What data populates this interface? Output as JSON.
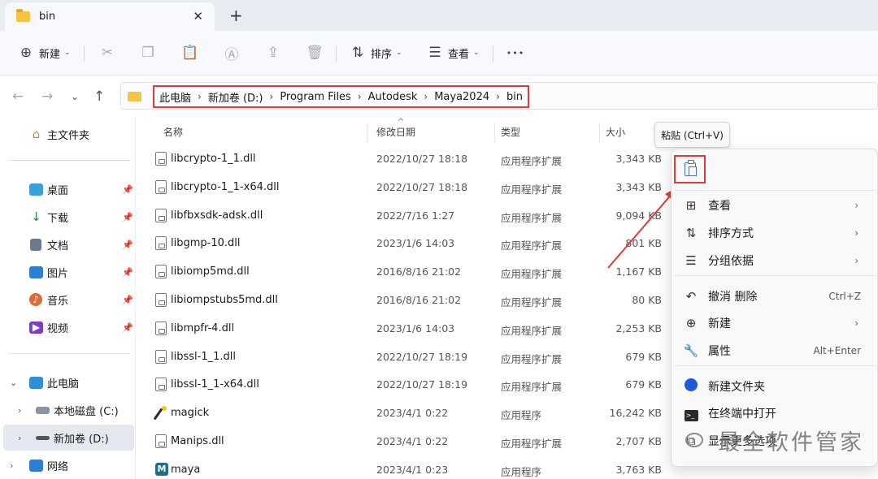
{
  "tab": {
    "title": "bin",
    "close_glyph": "✕",
    "new_tab_glyph": "+"
  },
  "toolbar": {
    "new_label": "新建",
    "sort_label": "排序",
    "view_label": "查看",
    "more_glyph": "•••"
  },
  "breadcrumb": [
    "此电脑",
    "新加卷 (D:)",
    "Program Files",
    "Autodesk",
    "Maya2024",
    "bin"
  ],
  "sidebar": {
    "home": "主文件夹",
    "pinned": [
      "桌面",
      "下载",
      "文档",
      "图片",
      "音乐",
      "视频"
    ],
    "this_pc": "此电脑",
    "drives": [
      "本地磁盘 (C:)",
      "新加卷 (D:)"
    ],
    "network": "网络"
  },
  "columns": {
    "name": "名称",
    "modified": "修改日期",
    "type": "类型",
    "size": "大小"
  },
  "files": [
    {
      "name": "libcrypto-1_1.dll",
      "modified": "2022/10/27 18:18",
      "type": "应用程序扩展",
      "size": "3,343 KB",
      "icon": "dll-icon"
    },
    {
      "name": "libcrypto-1_1-x64.dll",
      "modified": "2022/10/27 18:18",
      "type": "应用程序扩展",
      "size": "3,343 KB",
      "icon": "dll-icon"
    },
    {
      "name": "libfbxsdk-adsk.dll",
      "modified": "2022/7/16 1:27",
      "type": "应用程序扩展",
      "size": "9,094 KB",
      "icon": "dll-icon"
    },
    {
      "name": "libgmp-10.dll",
      "modified": "2023/1/6 14:03",
      "type": "应用程序扩展",
      "size": "801 KB",
      "icon": "dll-icon"
    },
    {
      "name": "libiomp5md.dll",
      "modified": "2016/8/16 21:02",
      "type": "应用程序扩展",
      "size": "1,167 KB",
      "icon": "dll-icon"
    },
    {
      "name": "libiompstubs5md.dll",
      "modified": "2016/8/16 21:02",
      "type": "应用程序扩展",
      "size": "80 KB",
      "icon": "dll-icon"
    },
    {
      "name": "libmpfr-4.dll",
      "modified": "2023/1/6 14:03",
      "type": "应用程序扩展",
      "size": "2,253 KB",
      "icon": "dll-icon"
    },
    {
      "name": "libssl-1_1.dll",
      "modified": "2022/10/27 18:19",
      "type": "应用程序扩展",
      "size": "679 KB",
      "icon": "dll-icon"
    },
    {
      "name": "libssl-1_1-x64.dll",
      "modified": "2022/10/27 18:19",
      "type": "应用程序扩展",
      "size": "679 KB",
      "icon": "dll-icon"
    },
    {
      "name": "magick",
      "modified": "2023/4/1 0:22",
      "type": "应用程序",
      "size": "16,242 KB",
      "icon": "magick-icon"
    },
    {
      "name": "Manips.dll",
      "modified": "2023/4/1 0:22",
      "type": "应用程序扩展",
      "size": "2,707 KB",
      "icon": "dll-icon"
    },
    {
      "name": "maya",
      "modified": "2023/4/1 0:23",
      "type": "应用程序",
      "size": "3,763 KB",
      "icon": "maya-icon"
    }
  ],
  "tooltip": "粘贴 (Ctrl+V)",
  "context_menu": {
    "items": [
      {
        "label": "查看",
        "shortcut": "",
        "has_submenu": true,
        "icon": "grid-icon"
      },
      {
        "label": "排序方式",
        "shortcut": "",
        "has_submenu": true,
        "icon": "sort-icon"
      },
      {
        "label": "分组依据",
        "shortcut": "",
        "has_submenu": true,
        "icon": "group-icon"
      },
      {
        "label": "撤消 删除",
        "shortcut": "Ctrl+Z",
        "has_submenu": false,
        "icon": "undo-icon"
      },
      {
        "label": "新建",
        "shortcut": "",
        "has_submenu": true,
        "icon": "plus-circle-icon"
      },
      {
        "label": "属性",
        "shortcut": "Alt+Enter",
        "has_submenu": false,
        "icon": "wrench-icon"
      },
      {
        "label": "新建文件夹",
        "shortcut": "",
        "has_submenu": false,
        "icon": "new-folder-icon"
      },
      {
        "label": "在终端中打开",
        "shortcut": "",
        "has_submenu": false,
        "icon": "terminal-icon"
      },
      {
        "label": "显示更多选项",
        "shortcut": "",
        "has_submenu": false,
        "icon": "more-options-icon"
      }
    ]
  },
  "watermark": "最全软件管家",
  "colors": {
    "highlight_red": "#e03b3b",
    "folder_yellow": "#f6c443",
    "selection_gray": "#e5e9ef"
  }
}
